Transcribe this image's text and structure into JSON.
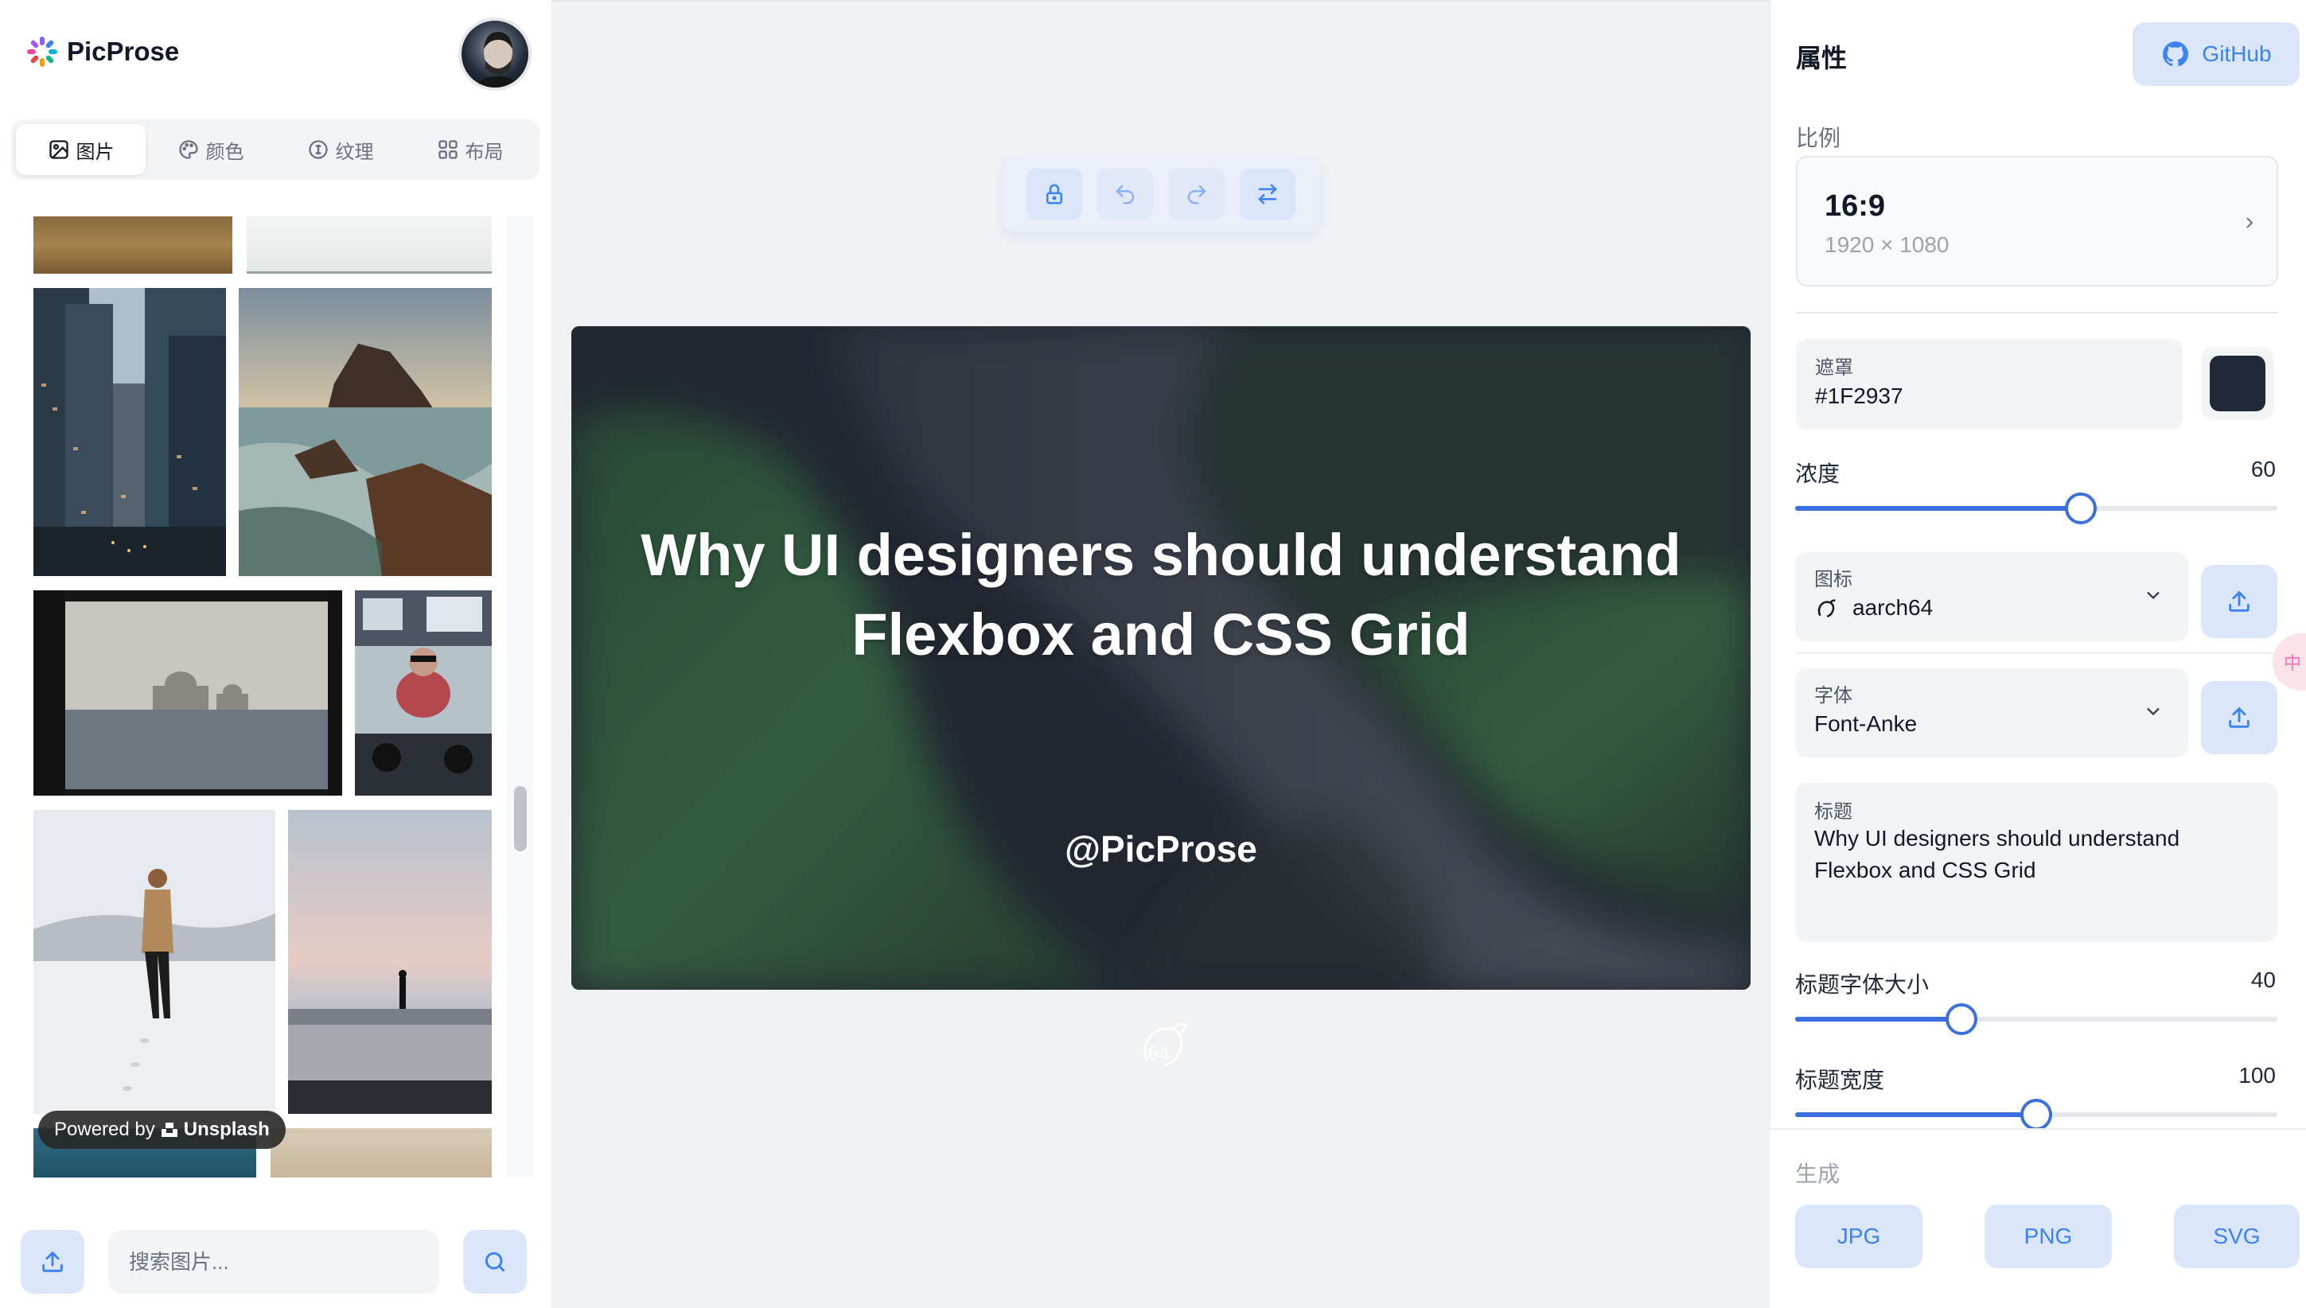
{
  "app": {
    "name": "PicProse"
  },
  "left": {
    "tabs": [
      {
        "label": "图片",
        "icon": "image-icon",
        "active": true
      },
      {
        "label": "颜色",
        "icon": "palette-icon",
        "active": false
      },
      {
        "label": "纹理",
        "icon": "texture-icon",
        "active": false
      },
      {
        "label": "布局",
        "icon": "layout-grid-icon",
        "active": false
      }
    ],
    "powered_prefix": "Powered by",
    "powered_brand": "Unsplash",
    "search_placeholder": "搜索图片..."
  },
  "canvas": {
    "title_line1": "Why UI designers should understand",
    "title_line2": "Flexbox and CSS Grid",
    "handle": "@PicProse",
    "mask_color": "#1F2937",
    "accent_green": "#3f7a45"
  },
  "right": {
    "title": "属性",
    "github_label": "GitHub",
    "ratio_label": "比例",
    "ratio_value": "16:9",
    "ratio_size": "1920 × 1080",
    "mask_label": "遮罩",
    "mask_value": "#1F2937",
    "opacity_label": "浓度",
    "opacity_value": "60",
    "opacity_max": 100,
    "icon_label": "图标",
    "icon_value": "aarch64",
    "font_label": "字体",
    "font_value": "Font-Anke",
    "heading_label": "标题",
    "heading_value": "Why UI designers should understand Flexbox and CSS Grid",
    "title_size_label": "标题字体大小",
    "title_size_value": "40",
    "title_size_fraction": 0.345,
    "title_width_label": "标题宽度",
    "title_width_value": "100",
    "title_width_fraction": 0.5,
    "generate_label": "生成",
    "formats": [
      "JPG",
      "PNG",
      "SVG"
    ],
    "pink_tab_label": "中"
  },
  "colors": {
    "accent": "#3b82f6",
    "accent_bg": "#dbe6fb",
    "slider": "#3b6fe0"
  }
}
